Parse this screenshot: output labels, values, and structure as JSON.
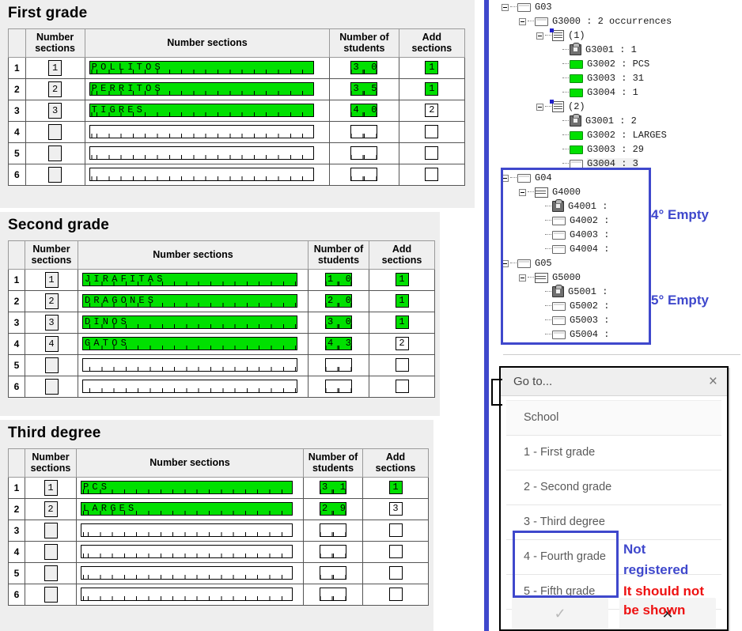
{
  "left_panel": {
    "grades": [
      {
        "title": "First grade",
        "columns": [
          "",
          "Number\nsections",
          "Number\nsections",
          "Number of\nstudents",
          "Add sections"
        ],
        "headers": {
          "num_sections": "Number sections",
          "section_name": "Number sections",
          "num_students": "Number of students",
          "add_sections": "Add sections"
        },
        "rows": [
          {
            "index": "1",
            "section_num": "1",
            "name": "POLLITOS",
            "students": "30",
            "add": "1",
            "filled": true,
            "add_filled": true
          },
          {
            "index": "2",
            "section_num": "2",
            "name": "PERRITOS",
            "students": "35",
            "add": "1",
            "filled": true,
            "add_filled": true
          },
          {
            "index": "3",
            "section_num": "3",
            "name": "TIGRES",
            "students": "40",
            "add": "2",
            "filled": true,
            "add_filled": false
          },
          {
            "index": "4",
            "section_num": "",
            "name": "",
            "students": "",
            "add": "",
            "filled": false,
            "add_filled": false
          },
          {
            "index": "5",
            "section_num": "",
            "name": "",
            "students": "",
            "add": "",
            "filled": false,
            "add_filled": false
          },
          {
            "index": "6",
            "section_num": "",
            "name": "",
            "students": "",
            "add": "",
            "filled": false,
            "add_filled": false
          }
        ]
      },
      {
        "title": "Second grade",
        "headers": {
          "num_sections": "Number sections",
          "section_name": "Number sections",
          "num_students": "Number of students",
          "add_sections": "Add sections"
        },
        "rows": [
          {
            "index": "1",
            "section_num": "1",
            "name": "JIRAFITAS",
            "students": "10",
            "add": "1",
            "filled": true,
            "add_filled": true
          },
          {
            "index": "2",
            "section_num": "2",
            "name": "DRAGONES",
            "students": "20",
            "add": "1",
            "filled": true,
            "add_filled": true
          },
          {
            "index": "3",
            "section_num": "3",
            "name": "DINOS",
            "students": "30",
            "add": "1",
            "filled": true,
            "add_filled": true
          },
          {
            "index": "4",
            "section_num": "4",
            "name": "GATOS",
            "students": "43",
            "add": "2",
            "filled": true,
            "add_filled": false
          },
          {
            "index": "5",
            "section_num": "",
            "name": "",
            "students": "",
            "add": "",
            "filled": false,
            "add_filled": false
          },
          {
            "index": "6",
            "section_num": "",
            "name": "",
            "students": "",
            "add": "",
            "filled": false,
            "add_filled": false
          }
        ]
      },
      {
        "title": "Third degree",
        "headers": {
          "num_sections": "Number sections",
          "section_name": "Number sections",
          "num_students": "Number of students",
          "add_sections": "Add sections"
        },
        "rows": [
          {
            "index": "1",
            "section_num": "1",
            "name": "PCS",
            "students": "31",
            "add": "1",
            "filled": true,
            "add_filled": true
          },
          {
            "index": "2",
            "section_num": "2",
            "name": "LARGES",
            "students": "29",
            "add": "3",
            "filled": true,
            "add_filled": false
          },
          {
            "index": "3",
            "section_num": "",
            "name": "",
            "students": "",
            "add": "",
            "filled": false,
            "add_filled": false
          },
          {
            "index": "4",
            "section_num": "",
            "name": "",
            "students": "",
            "add": "",
            "filled": false,
            "add_filled": false
          },
          {
            "index": "5",
            "section_num": "",
            "name": "",
            "students": "",
            "add": "",
            "filled": false,
            "add_filled": false
          },
          {
            "index": "6",
            "section_num": "",
            "name": "",
            "students": "",
            "add": "",
            "filled": false,
            "add_filled": false
          }
        ]
      }
    ]
  },
  "right_panel": {
    "tree": [
      {
        "depth": 0,
        "icon": "folder-rect-icon",
        "expander": true,
        "label": "G03"
      },
      {
        "depth": 1,
        "icon": "folder-rect-icon",
        "expander": true,
        "label": "G3000 : 2 occurrences"
      },
      {
        "depth": 2,
        "icon": "record-list-icon",
        "expander": true,
        "label": "(1)"
      },
      {
        "depth": 3,
        "icon": "lock-icon",
        "expander": false,
        "label": "G3001 : 1"
      },
      {
        "depth": 3,
        "icon": "green-rect-icon",
        "expander": false,
        "label": "G3002 : PCS"
      },
      {
        "depth": 3,
        "icon": "green-rect-icon",
        "expander": false,
        "label": "G3003 : 31"
      },
      {
        "depth": 3,
        "icon": "green-rect-icon",
        "expander": false,
        "label": "G3004 : 1"
      },
      {
        "depth": 2,
        "icon": "record-list-icon",
        "expander": true,
        "label": "(2)"
      },
      {
        "depth": 3,
        "icon": "lock-icon",
        "expander": false,
        "label": "G3001 : 2"
      },
      {
        "depth": 3,
        "icon": "green-rect-icon",
        "expander": false,
        "label": "G3002 : LARGES"
      },
      {
        "depth": 3,
        "icon": "green-rect-icon",
        "expander": false,
        "label": "G3003 : 29"
      },
      {
        "depth": 3,
        "icon": "folder-rect-icon",
        "expander": false,
        "label": "G3004 : 3",
        "selected": true
      },
      {
        "depth": 0,
        "icon": "folder-rect-icon",
        "expander": true,
        "label": "G04"
      },
      {
        "depth": 1,
        "icon": "lines-icon",
        "expander": true,
        "label": "G4000"
      },
      {
        "depth": 2,
        "icon": "lock-icon",
        "expander": false,
        "label": "G4001 :"
      },
      {
        "depth": 2,
        "icon": "folder-rect-icon",
        "expander": false,
        "label": "G4002 :"
      },
      {
        "depth": 2,
        "icon": "folder-rect-icon",
        "expander": false,
        "label": "G4003 :"
      },
      {
        "depth": 2,
        "icon": "folder-rect-icon",
        "expander": false,
        "label": "G4004 :"
      },
      {
        "depth": 0,
        "icon": "folder-rect-icon",
        "expander": true,
        "label": "G05"
      },
      {
        "depth": 1,
        "icon": "lines-icon",
        "expander": true,
        "label": "G5000"
      },
      {
        "depth": 2,
        "icon": "lock-icon",
        "expander": false,
        "label": "G5001 :"
      },
      {
        "depth": 2,
        "icon": "folder-rect-icon",
        "expander": false,
        "label": "G5002 :"
      },
      {
        "depth": 2,
        "icon": "folder-rect-icon",
        "expander": false,
        "label": "G5003 :"
      },
      {
        "depth": 2,
        "icon": "folder-rect-icon",
        "expander": false,
        "label": "G5004 :"
      }
    ],
    "annotations": {
      "fourth_empty": "4° Empty",
      "fifth_empty": "5° Empty",
      "not_registered_line1": "Not",
      "not_registered_line2": "registered",
      "should_not_line1": "It should not",
      "should_not_line2": "be shown"
    }
  },
  "goto_dialog": {
    "title": "Go to...",
    "close_label": "×",
    "items": [
      {
        "label": "School"
      },
      {
        "label": "1 - First grade"
      },
      {
        "label": "2 - Second grade"
      },
      {
        "label": "3 - Third degree"
      },
      {
        "label": "4 - Fourth grade"
      },
      {
        "label": "5 - Fifth grade"
      }
    ],
    "confirm_label": "✓",
    "cancel_label": "✕"
  },
  "colors": {
    "accent_blue": "#3f48cc",
    "alert_red": "#ee1111",
    "field_green": "#00e000",
    "panel_grey": "#eeeeee"
  }
}
